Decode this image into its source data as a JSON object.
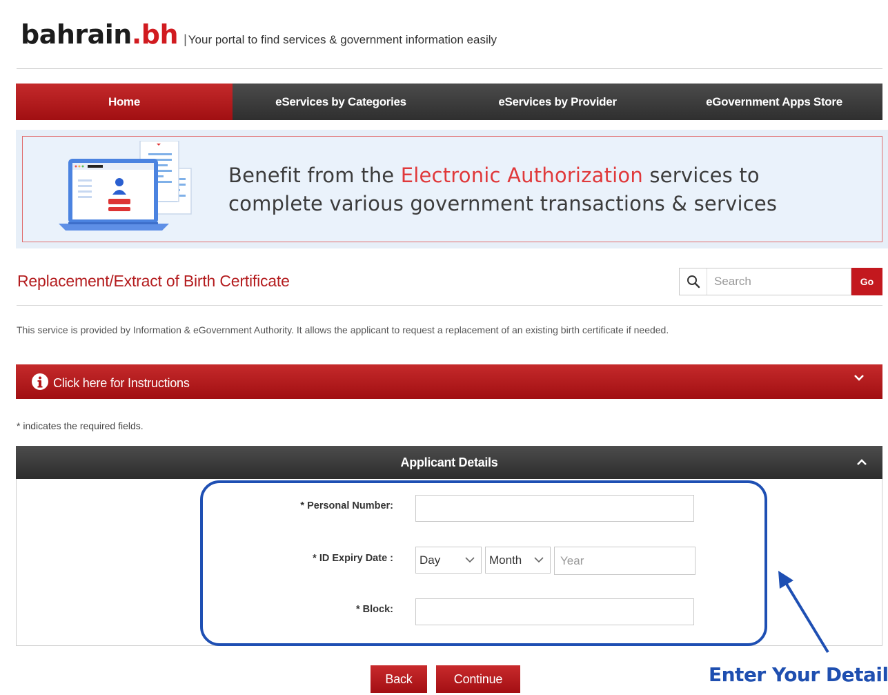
{
  "header": {
    "logo_main": "bahrain",
    "logo_tld": ".bh",
    "separator": "|",
    "tagline": "Your portal to find services & government information easily"
  },
  "nav": {
    "items": [
      {
        "label": "Home",
        "active": true
      },
      {
        "label": "eServices by Categories",
        "active": false
      },
      {
        "label": "eServices by Provider",
        "active": false
      },
      {
        "label": "eGovernment Apps Store",
        "active": false
      }
    ]
  },
  "banner": {
    "line1_prefix": "Benefit from the ",
    "line1_highlight": "Electronic Authorization",
    "line1_suffix": " services to",
    "line2": "complete various government transactions & services"
  },
  "service": {
    "title": "Replacement/Extract of Birth Certificate",
    "description": "This service is provided by Information & eGovernment Authority. It allows the applicant to request a replacement of an existing birth certificate if needed."
  },
  "search": {
    "placeholder": "Search",
    "go_label": "Go"
  },
  "instructions": {
    "label": "Click here for Instructions"
  },
  "required_note": "* indicates the required fields.",
  "panel": {
    "title": "Applicant Details",
    "fields": {
      "personal_number_label": "* Personal Number:",
      "personal_number_value": "",
      "id_expiry_label": "* ID Expiry Date :",
      "day_value": "Day",
      "month_value": "Month",
      "year_placeholder": "Year",
      "block_label": "* Block:",
      "block_value": ""
    }
  },
  "buttons": {
    "back": "Back",
    "continue": "Continue"
  },
  "annotation": {
    "text": "Enter Your Detail"
  },
  "colors": {
    "brand_red": "#c3181e",
    "nav_dark": "#3a3a3a",
    "annotation_blue": "#1e4fb3"
  }
}
